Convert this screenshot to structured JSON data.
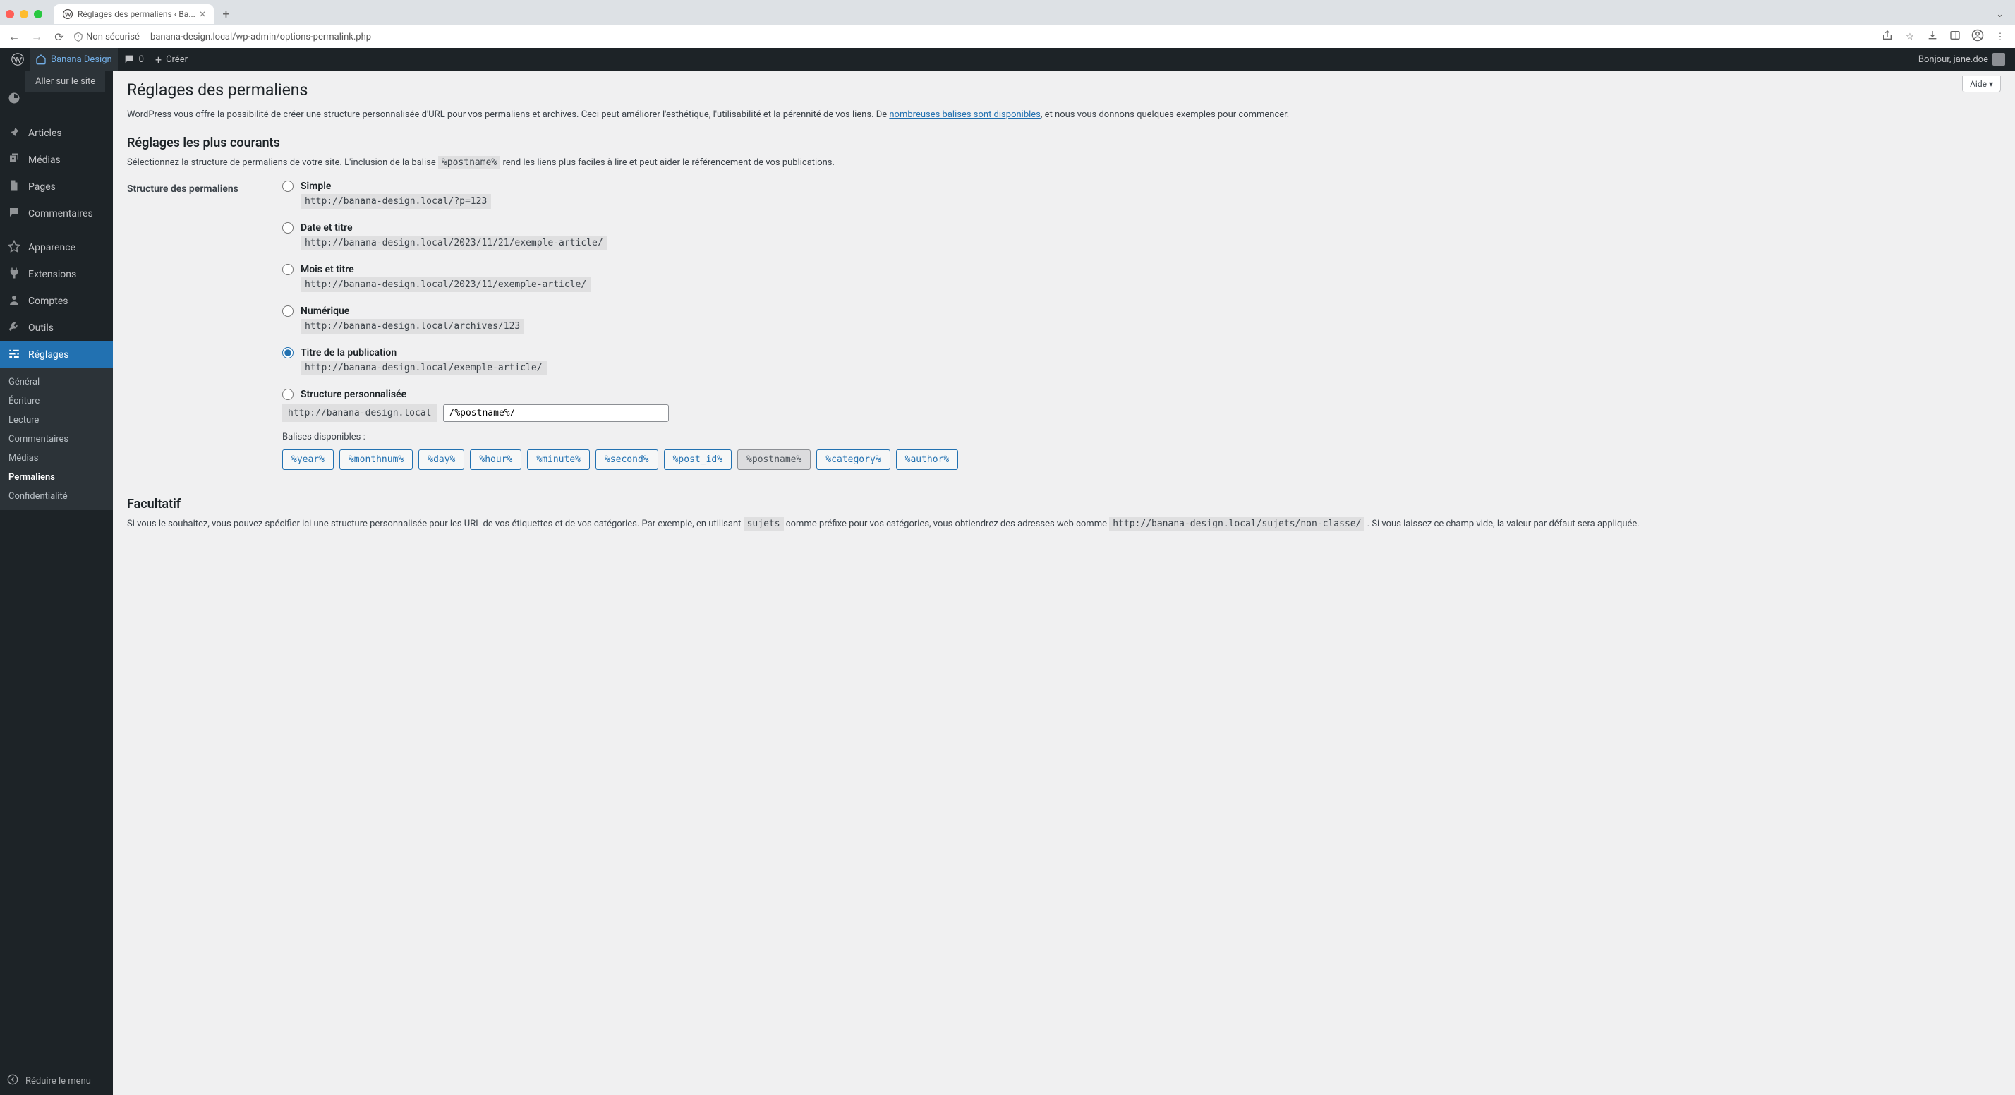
{
  "browser": {
    "tab_title": "Réglages des permaliens ‹ Ba...",
    "url_insecure": "Non sécurisé",
    "url_host": "banana-design.local",
    "url_path": "/wp-admin/options-permalink.php"
  },
  "toolbar": {
    "site_name": "Banana Design",
    "comments_count": "0",
    "create_label": "Créer",
    "greeting": "Bonjour, jane.doe",
    "hover_submenu": "Aller sur le site"
  },
  "sidebar": {
    "dashboard": "Tableau de bord",
    "items": [
      {
        "label": "Articles",
        "icon": "pin-icon"
      },
      {
        "label": "Médias",
        "icon": "media-icon"
      },
      {
        "label": "Pages",
        "icon": "pages-icon"
      },
      {
        "label": "Commentaires",
        "icon": "comments-icon"
      },
      {
        "label": "Apparence",
        "icon": "appearance-icon"
      },
      {
        "label": "Extensions",
        "icon": "plugins-icon"
      },
      {
        "label": "Comptes",
        "icon": "users-icon"
      },
      {
        "label": "Outils",
        "icon": "tools-icon"
      },
      {
        "label": "Réglages",
        "icon": "settings-icon"
      }
    ],
    "submenu": [
      "Général",
      "Écriture",
      "Lecture",
      "Commentaires",
      "Médias",
      "Permaliens",
      "Confidentialité"
    ],
    "collapse": "Réduire le menu"
  },
  "content": {
    "help_label": "Aide",
    "page_title": "Réglages des permaliens",
    "intro_text_1": "WordPress vous offre la possibilité de créer une structure personnalisée d'URL pour vos permaliens et archives. Ceci peut améliorer l'esthétique, l'utilisabilité et la pérennité de vos liens. De ",
    "intro_link": "nombreuses balises sont disponibles",
    "intro_text_2": ", et nous vous donnons quelques exemples pour commencer.",
    "section_common_title": "Réglages les plus courants",
    "section_common_sub_1": "Sélectionnez la structure de permaliens de votre site. L'inclusion de la balise ",
    "section_common_tag": "%postname%",
    "section_common_sub_2": " rend les liens plus faciles à lire et peut aider le référencement de vos publications.",
    "form_label": "Structure des permaliens",
    "options": [
      {
        "label": "Simple",
        "example": "http://banana-design.local/?p=123"
      },
      {
        "label": "Date et titre",
        "example": "http://banana-design.local/2023/11/21/exemple-article/"
      },
      {
        "label": "Mois et titre",
        "example": "http://banana-design.local/2023/11/exemple-article/"
      },
      {
        "label": "Numérique",
        "example": "http://banana-design.local/archives/123"
      },
      {
        "label": "Titre de la publication",
        "example": "http://banana-design.local/exemple-article/"
      },
      {
        "label": "Structure personnalisée"
      }
    ],
    "custom_prefix": "http://banana-design.local",
    "custom_value": "/%postname%/",
    "balises_label": "Balises disponibles :",
    "balises": [
      "%year%",
      "%monthnum%",
      "%day%",
      "%hour%",
      "%minute%",
      "%second%",
      "%post_id%",
      "%postname%",
      "%category%",
      "%author%"
    ],
    "optional_title": "Facultatif",
    "optional_text_1": "Si vous le souhaitez, vous pouvez spécifier ici une structure personnalisée pour les URL de vos étiquettes et de vos catégories. Par exemple, en utilisant ",
    "optional_code_1": "sujets",
    "optional_text_2": " comme préfixe pour vos catégories, vous obtiendrez des adresses web comme ",
    "optional_code_2": "http://banana-design.local/sujets/non-classe/",
    "optional_text_3": " . Si vous laissez ce champ vide, la valeur par défaut sera appliquée."
  }
}
